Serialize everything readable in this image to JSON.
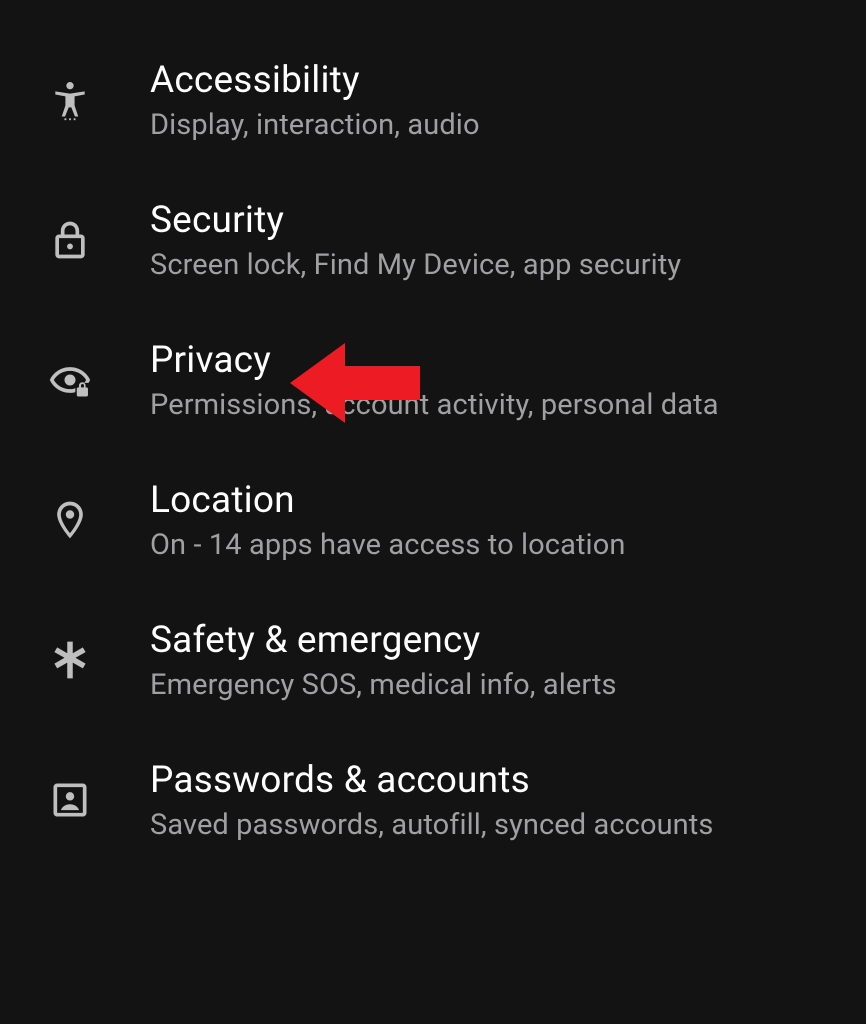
{
  "settings": {
    "items": [
      {
        "title": "Accessibility",
        "subtitle": "Display, interaction, audio"
      },
      {
        "title": "Security",
        "subtitle": "Screen lock, Find My Device, app security"
      },
      {
        "title": "Privacy",
        "subtitle": "Permissions, account activity, personal data"
      },
      {
        "title": "Location",
        "subtitle": "On - 14 apps have access to location"
      },
      {
        "title": "Safety & emergency",
        "subtitle": "Emergency SOS, medical info, alerts"
      },
      {
        "title": "Passwords & accounts",
        "subtitle": "Saved passwords, autofill, synced accounts"
      }
    ]
  },
  "annotation": {
    "target": "settings-item-privacy"
  }
}
